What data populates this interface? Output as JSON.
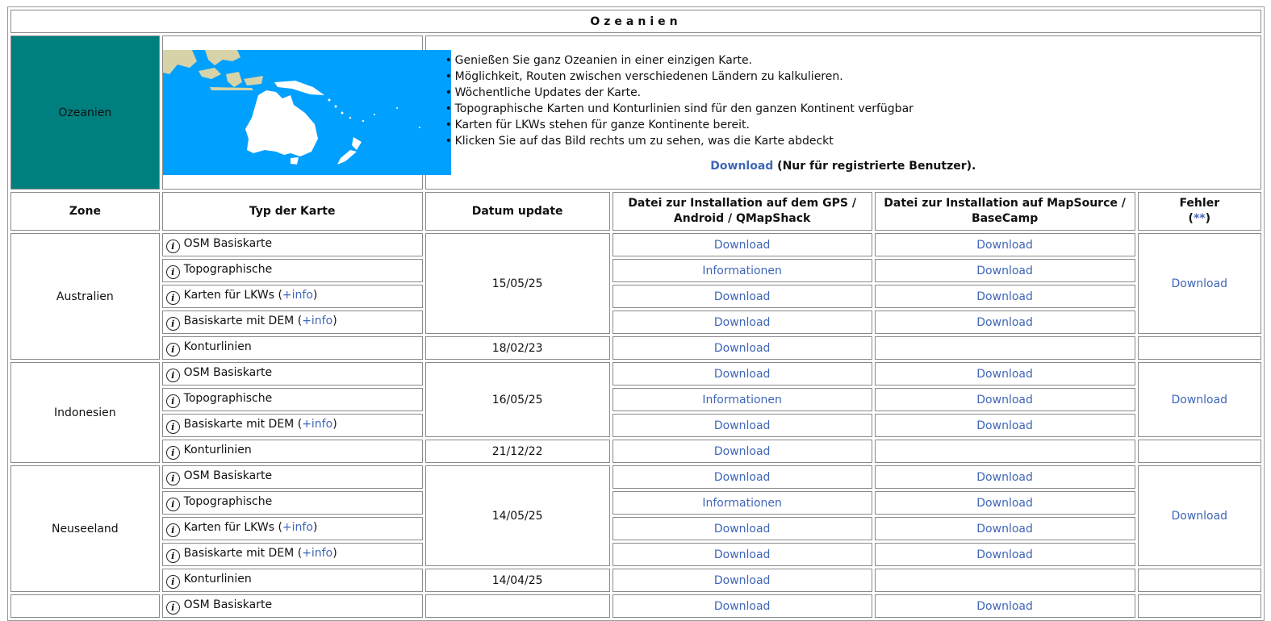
{
  "title": "Ozeanien",
  "region_label": "Ozeanien",
  "colors": {
    "region_bg": "#007f7f",
    "map_sea": "#00a0ff",
    "map_land": "#ffffff",
    "map_land_other": "#d6d3a8",
    "link": "#3f66b8"
  },
  "features": [
    "Genießen Sie ganz Ozeanien in einer einzigen Karte.",
    "Möglichkeit, Routen zwischen verschiedenen Ländern zu kalkulieren.",
    "Wöchentliche Updates der Karte.",
    "Topographische Karten und Konturlinien sind für den ganzen Kontinent verfügbar",
    "Karten für LKWs stehen für ganze Kontinente bereit.",
    "Klicken Sie auf das Bild rechts um zu sehen, was die Karte abdeckt"
  ],
  "main_download": {
    "link": "Download",
    "note": "(Nur für registrierte Benutzer)."
  },
  "headers": {
    "zone": "Zone",
    "type": "Typ der Karte",
    "date": "Datum update",
    "gps": "Datei zur Installation auf dem GPS / Android / QMapShack",
    "mapsource": "Datei zur Installation auf MapSource / BaseCamp",
    "errors": "Fehler",
    "errors_link": "**",
    "errors_open": "(",
    "errors_close": ")"
  },
  "labels": {
    "download": "Download",
    "informationen": "Informationen",
    "plus_info": "+info",
    "info_icon_glyph": "i"
  },
  "zones": [
    {
      "name": "Australien",
      "main_date": "15/05/25",
      "contour_date": "18/02/23",
      "errors_link": "Download",
      "rows": [
        {
          "type": "OSM Basiskarte",
          "gps": "Download",
          "ms": "Download"
        },
        {
          "type": "Topographische",
          "gps": "Informationen",
          "ms": "Download"
        },
        {
          "type": "Karten für LKWs",
          "info": "+info",
          "gps": "Download",
          "ms": "Download"
        },
        {
          "type": "Basiskarte mit DEM",
          "info": "+info",
          "gps": "Download",
          "ms": "Download"
        },
        {
          "type": "Konturlinien",
          "gps": "Download",
          "ms": ""
        }
      ]
    },
    {
      "name": "Indonesien",
      "main_date": "16/05/25",
      "contour_date": "21/12/22",
      "errors_link": "Download",
      "rows": [
        {
          "type": "OSM Basiskarte",
          "gps": "Download",
          "ms": "Download"
        },
        {
          "type": "Topographische",
          "gps": "Informationen",
          "ms": "Download"
        },
        {
          "type": "Basiskarte mit DEM",
          "info": "+info",
          "gps": "Download",
          "ms": "Download"
        },
        {
          "type": "Konturlinien",
          "gps": "Download",
          "ms": ""
        }
      ]
    },
    {
      "name": "Neuseeland",
      "main_date": "14/05/25",
      "contour_date": "14/04/25",
      "errors_link": "Download",
      "rows": [
        {
          "type": "OSM Basiskarte",
          "gps": "Download",
          "ms": "Download"
        },
        {
          "type": "Topographische",
          "gps": "Informationen",
          "ms": "Download"
        },
        {
          "type": "Karten für LKWs",
          "info": "+info",
          "gps": "Download",
          "ms": "Download"
        },
        {
          "type": "Basiskarte mit DEM",
          "info": "+info",
          "gps": "Download",
          "ms": "Download"
        },
        {
          "type": "Konturlinien",
          "gps": "Download",
          "ms": ""
        }
      ]
    },
    {
      "name": "",
      "main_date": "",
      "contour_date": "",
      "errors_link": "",
      "rows": [
        {
          "type": "OSM Basiskarte",
          "gps": "Download",
          "ms": "Download"
        }
      ]
    }
  ]
}
